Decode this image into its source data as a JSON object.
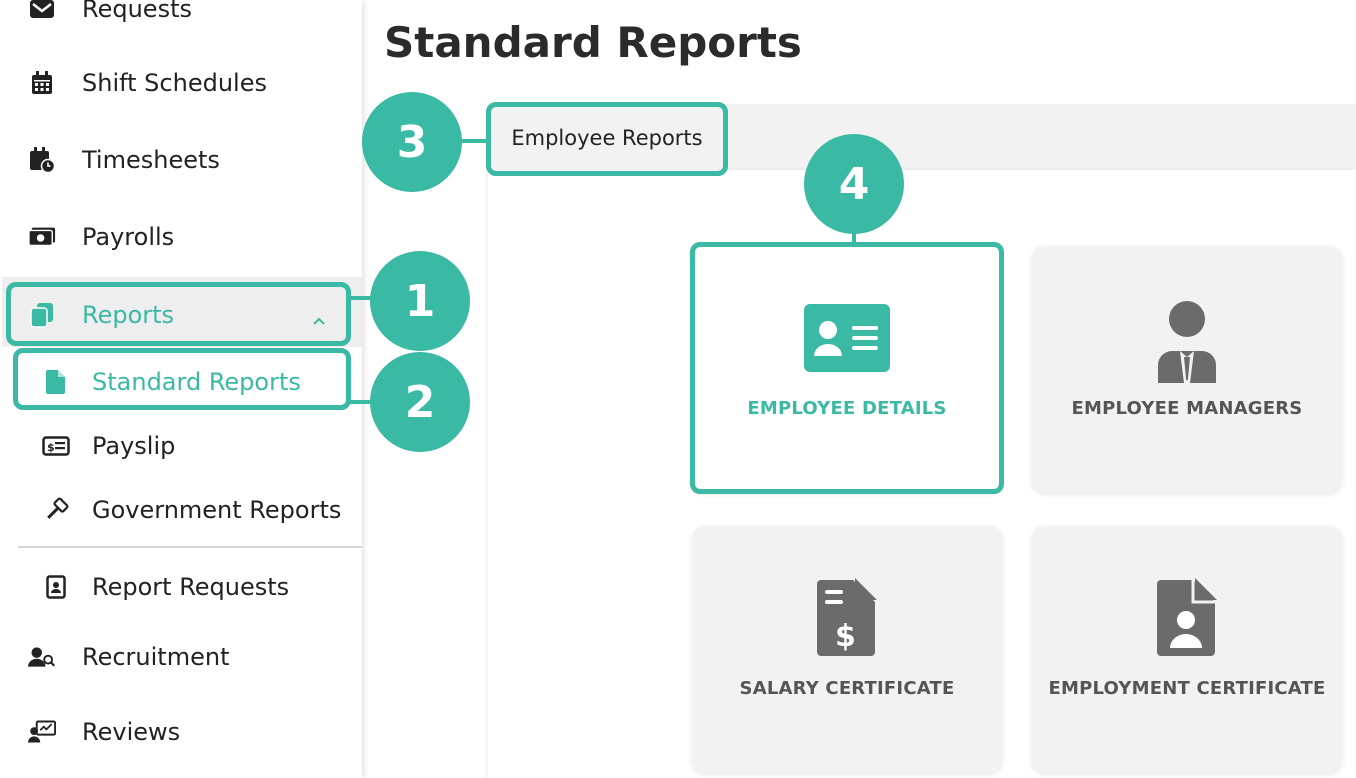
{
  "sidebar": {
    "items": [
      {
        "label": "Requests",
        "icon": "envelope-check-icon"
      },
      {
        "label": "Shift Schedules",
        "icon": "calendar-icon"
      },
      {
        "label": "Timesheets",
        "icon": "calendar-clock-icon"
      },
      {
        "label": "Payrolls",
        "icon": "money-bill-icon"
      },
      {
        "label": "Reports",
        "icon": "copy-icon",
        "expanded": true
      },
      {
        "label": "Standard Reports",
        "icon": "file-icon",
        "active": true
      },
      {
        "label": "Payslip",
        "icon": "money-check-icon"
      },
      {
        "label": "Government Reports",
        "icon": "gavel-icon"
      },
      {
        "label": "Report Requests",
        "icon": "file-user-icon"
      },
      {
        "label": "Recruitment",
        "icon": "user-search-icon"
      },
      {
        "label": "Reviews",
        "icon": "user-chart-icon"
      }
    ]
  },
  "main": {
    "title": "Standard Reports",
    "tab": "Employee Reports",
    "cards": [
      {
        "label": "EMPLOYEE DETAILS",
        "icon": "id-card-icon",
        "selected": true
      },
      {
        "label": "EMPLOYEE MANAGERS",
        "icon": "user-tie-icon"
      },
      {
        "label": "SALARY CERTIFICATE",
        "icon": "file-invoice-dollar-icon"
      },
      {
        "label": "EMPLOYMENT CERTIFICATE",
        "icon": "file-user-icon"
      }
    ]
  },
  "callouts": [
    "1",
    "2",
    "3",
    "4"
  ],
  "colors": {
    "accent": "#3ab9a4",
    "card_bg": "#f2f2f2",
    "icon_gray": "#6b6b6b"
  }
}
